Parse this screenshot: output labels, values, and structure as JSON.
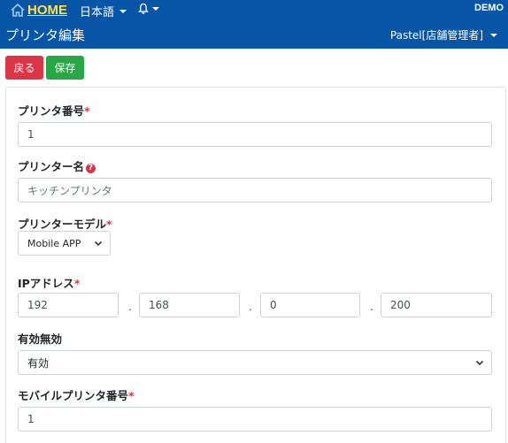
{
  "header": {
    "home_label": "HOME",
    "language": "日本語",
    "company": "DEMO",
    "page_title": "プリンタ編集",
    "store_user": "Pastel[店舗管理者]"
  },
  "toolbar": {
    "back_label": "戻る",
    "save_label": "保存"
  },
  "form": {
    "printer_number": {
      "label": "プリンタ番号",
      "required": "*",
      "value": "1"
    },
    "printer_name": {
      "label": "プリンター名",
      "help": "?",
      "placeholder": "キッチンプリンタ"
    },
    "printer_model": {
      "label": "プリンターモデル",
      "required": "*",
      "value": "Mobile APP"
    },
    "ip_address": {
      "label": "IPアドレス",
      "required": "*",
      "octets": [
        "192",
        "168",
        "0",
        "200"
      ],
      "separator": "."
    },
    "enabled": {
      "label": "有効無効",
      "value": "有効"
    },
    "mobile_printer_number": {
      "label": "モバイルプリンタ番号",
      "required": "*",
      "value": "1"
    }
  },
  "colors": {
    "header_bg": "#0755a6",
    "home": "#ffe14d",
    "danger": "#dc3545",
    "success": "#28a745"
  },
  "icons": [
    "home-icon",
    "bell-icon",
    "caret-down-icon",
    "help-icon",
    "chevron-down-icon"
  ]
}
